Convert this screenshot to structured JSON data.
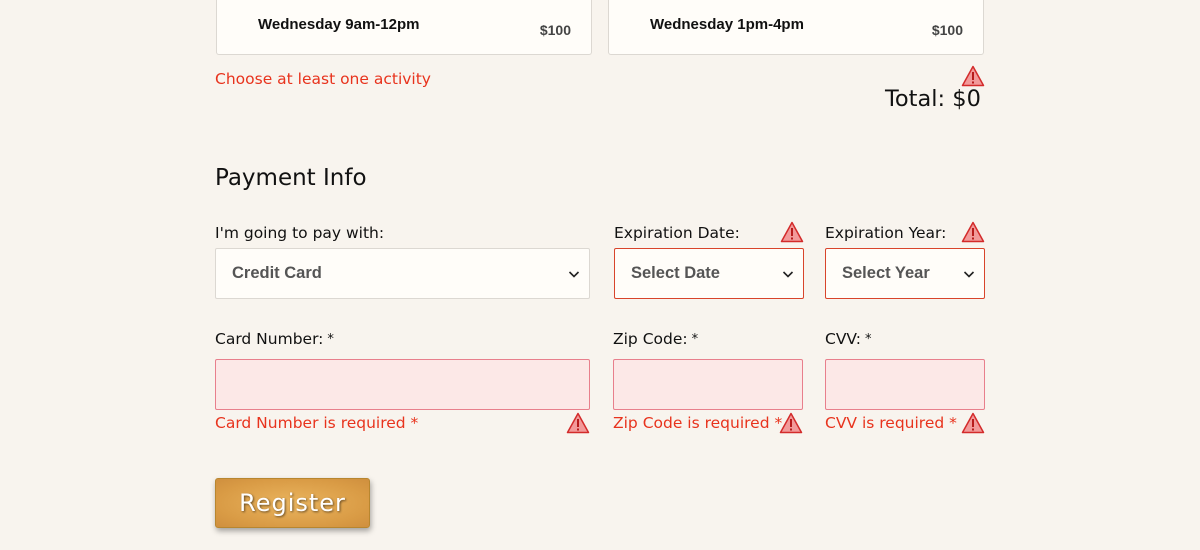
{
  "activities": [
    {
      "name": "Wednesday 9am-12pm",
      "price": "$100"
    },
    {
      "name": "Wednesday 1pm-4pm",
      "price": "$100"
    }
  ],
  "activity_error": "Choose at least one activity",
  "total": "Total: $0",
  "payment": {
    "title": "Payment Info",
    "pay_with_label": "I'm going to pay with:",
    "pay_with_value": "Credit Card",
    "exp_date_label": "Expiration Date:",
    "exp_date_value": "Select Date",
    "exp_year_label": "Expiration Year:",
    "exp_year_value": "Select Year",
    "card_number_label": "Card Number:",
    "zip_label": "Zip Code:",
    "cvv_label": "CVV:",
    "required_marker": "*",
    "card_number_error": "Card Number is required *",
    "zip_error": "Zip Code is required *",
    "cvv_error": "CVV is required *"
  },
  "register_label": "Register",
  "icons": {
    "warning": "warning-icon",
    "chevron": "chevron-down-icon"
  },
  "colors": {
    "error": "#e8331d",
    "warning_fill": "#f29a9a",
    "warning_stroke": "#d32b2b",
    "invalid_input_bg": "#fce8e7",
    "button": "#d99b45"
  }
}
